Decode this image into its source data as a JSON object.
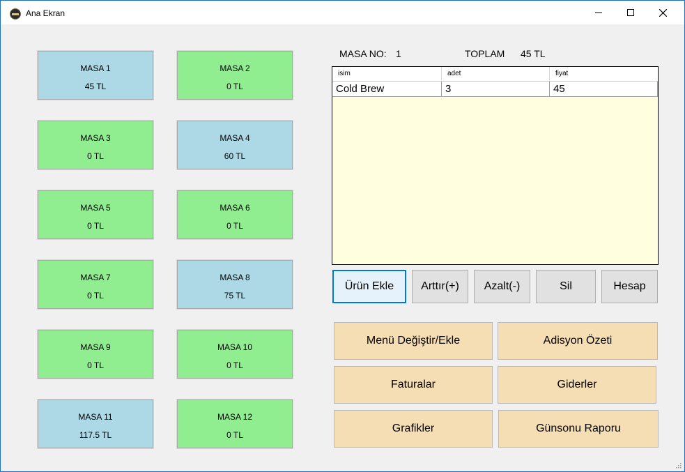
{
  "window": {
    "title": "Ana Ekran"
  },
  "titlebar": {
    "minimize_icon": "minimize-icon",
    "maximize_icon": "maximize-icon",
    "close_icon": "close-icon"
  },
  "tables": [
    {
      "name": "MASA 1",
      "amount": "45  TL",
      "status": "occupied"
    },
    {
      "name": "MASA 2",
      "amount": "0  TL",
      "status": "free"
    },
    {
      "name": "MASA 3",
      "amount": "0  TL",
      "status": "free"
    },
    {
      "name": "MASA 4",
      "amount": "60  TL",
      "status": "occupied"
    },
    {
      "name": "MASA 5",
      "amount": "0  TL",
      "status": "free"
    },
    {
      "name": "MASA 6",
      "amount": "0  TL",
      "status": "free"
    },
    {
      "name": "MASA 7",
      "amount": "0  TL",
      "status": "free"
    },
    {
      "name": "MASA 8",
      "amount": "75  TL",
      "status": "occupied"
    },
    {
      "name": "MASA 9",
      "amount": "0  TL",
      "status": "free"
    },
    {
      "name": "MASA 10",
      "amount": "0  TL",
      "status": "free"
    },
    {
      "name": "MASA 11",
      "amount": "117.5  TL",
      "status": "occupied"
    },
    {
      "name": "MASA 12",
      "amount": "0  TL",
      "status": "free"
    }
  ],
  "colors": {
    "free": "#90ee90",
    "occupied": "#add8e6",
    "grid_bg": "#ffffe0",
    "action_bg": "#f5deb3"
  },
  "order": {
    "masa_no_label": "MASA NO:",
    "masa_no_value": "1",
    "toplam_label": "TOPLAM",
    "toplam_value": "45 TL",
    "columns": [
      "isim",
      "adet",
      "fiyat"
    ],
    "rows": [
      [
        "Cold Brew",
        "3",
        "45"
      ]
    ]
  },
  "buttons": {
    "urun_ekle": "Ürün Ekle",
    "arttir": "Arttır(+)",
    "azalt": "Azalt(-)",
    "sil": "Sil",
    "hesap": "Hesap"
  },
  "actions": {
    "menu": "Menü Değiştir/Ekle",
    "adisyon": "Adisyon Özeti",
    "faturalar": "Faturalar",
    "giderler": "Giderler",
    "grafikler": "Grafikler",
    "gunsonu": "Günsonu Raporu"
  }
}
